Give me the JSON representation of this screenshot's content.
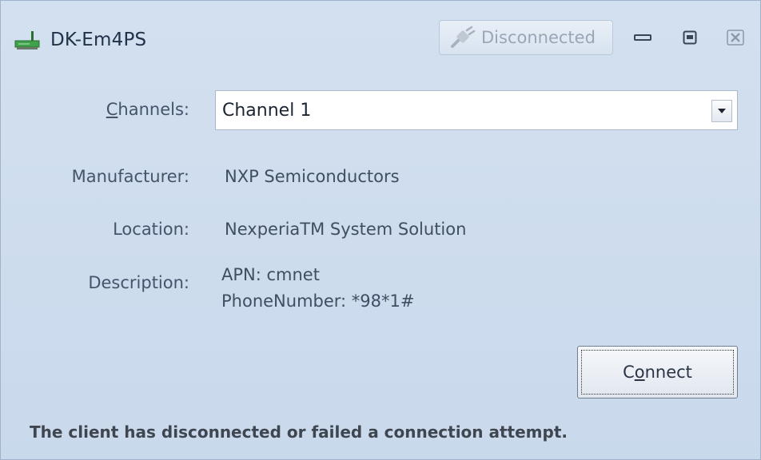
{
  "window": {
    "title": "DK-Em4PS",
    "status_button": "Disconnected"
  },
  "form": {
    "channels": {
      "label_access": "C",
      "label_rest": "hannels:",
      "selected": "Channel 1"
    },
    "manufacturer": {
      "label": "Manufacturer:",
      "value": "NXP Semiconductors"
    },
    "location": {
      "label": "Location:",
      "value": "NexperiaTM System Solution"
    },
    "description": {
      "label": "Description:",
      "line1": "APN: cmnet",
      "line2": "PhoneNumber: *98*1#"
    }
  },
  "connect_button": {
    "pre": "C",
    "access": "o",
    "post": "nnect"
  },
  "status_message": "The client has disconnected or failed a connection attempt.",
  "icons": {
    "app": "network-card-icon",
    "status": "plug-icon",
    "minimize": "minimize-icon",
    "maximize": "maximize-icon",
    "close": "close-icon",
    "dropdown": "chevron-down-icon"
  },
  "colors": {
    "window_bg": "#d3e0ef",
    "status_disabled": "#9aa6b6",
    "close_icon": "#8a99ac"
  }
}
